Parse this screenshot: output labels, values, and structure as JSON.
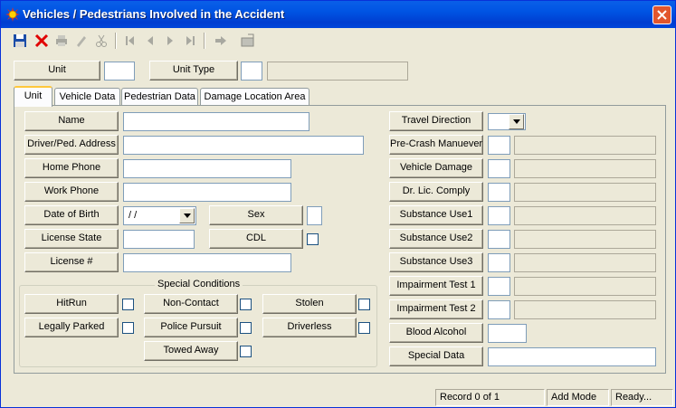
{
  "window": {
    "title": "Vehicles / Pedestrians Involved in the Accident",
    "close_label": "X"
  },
  "toolbar": {
    "save": "save-icon",
    "delete": "delete-icon",
    "print": "print-icon",
    "edit": "pencil-icon",
    "cut": "scissors-icon",
    "first": "first-record-icon",
    "prev": "previous-record-icon",
    "next": "next-record-icon",
    "last": "last-record-icon",
    "go": "go-icon",
    "export": "export-icon"
  },
  "header": {
    "unit_label": "Unit",
    "unit_value": "",
    "unit_type_label": "Unit Type",
    "unit_type_code": "",
    "unit_type_desc": ""
  },
  "tabs": [
    {
      "label": "Unit",
      "active": true
    },
    {
      "label": "Vehicle Data",
      "active": false
    },
    {
      "label": "Pedestrian Data",
      "active": false
    },
    {
      "label": "Damage Location Area",
      "active": false
    }
  ],
  "left_fields": {
    "name_label": "Name",
    "name_value": "",
    "address_label": "Driver/Ped. Address",
    "address_value": "",
    "home_phone_label": "Home Phone",
    "home_phone_value": "",
    "work_phone_label": "Work Phone",
    "work_phone_value": "",
    "dob_label": "Date of Birth",
    "dob_value": " / /",
    "sex_label": "Sex",
    "sex_value": "",
    "license_state_label": "License State",
    "license_state_value": "",
    "cdl_label": "CDL",
    "cdl_checked": false,
    "license_no_label": "License #",
    "license_no_value": ""
  },
  "special_conditions": {
    "title": "Special Conditions",
    "hitrun": "HitRun",
    "non_contact": "Non-Contact",
    "stolen": "Stolen",
    "legally_parked": "Legally Parked",
    "police_pursuit": "Police Pursuit",
    "driverless": "Driverless",
    "towed_away": "Towed Away"
  },
  "right_fields": {
    "travel_direction": "Travel Direction",
    "pre_crash": "Pre-Crash Manuever",
    "vehicle_damage": "Vehicle Damage",
    "dr_lic_comply": "Dr. Lic. Comply",
    "substance_use1": "Substance Use1",
    "substance_use2": "Substance Use2",
    "substance_use3": "Substance Use3",
    "impairment_test1": "Impairment Test 1",
    "impairment_test2": "Impairment Test 2",
    "blood_alcohol": "Blood Alcohol",
    "special_data": "Special Data"
  },
  "status": {
    "record": "Record 0 of 1",
    "mode": "Add Mode",
    "state": "Ready..."
  }
}
